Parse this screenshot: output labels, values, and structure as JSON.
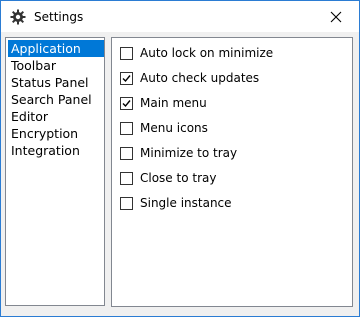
{
  "window": {
    "title": "Settings",
    "border_color": "#2b7cd3",
    "icon": "gear-icon",
    "close_icon": "close-icon"
  },
  "nav": {
    "items": [
      {
        "label": "Application",
        "selected": true
      },
      {
        "label": "Toolbar",
        "selected": false
      },
      {
        "label": "Status Panel",
        "selected": false
      },
      {
        "label": "Search Panel",
        "selected": false
      },
      {
        "label": "Editor",
        "selected": false
      },
      {
        "label": "Encryption",
        "selected": false
      },
      {
        "label": "Integration",
        "selected": false
      }
    ],
    "selected_color": "#0078d7"
  },
  "options": [
    {
      "label": "Auto lock on minimize",
      "checked": false
    },
    {
      "label": "Auto check updates",
      "checked": true
    },
    {
      "label": "Main menu",
      "checked": true
    },
    {
      "label": "Menu icons",
      "checked": false
    },
    {
      "label": "Minimize to tray",
      "checked": false
    },
    {
      "label": "Close to tray",
      "checked": false
    },
    {
      "label": "Single instance",
      "checked": false
    }
  ]
}
